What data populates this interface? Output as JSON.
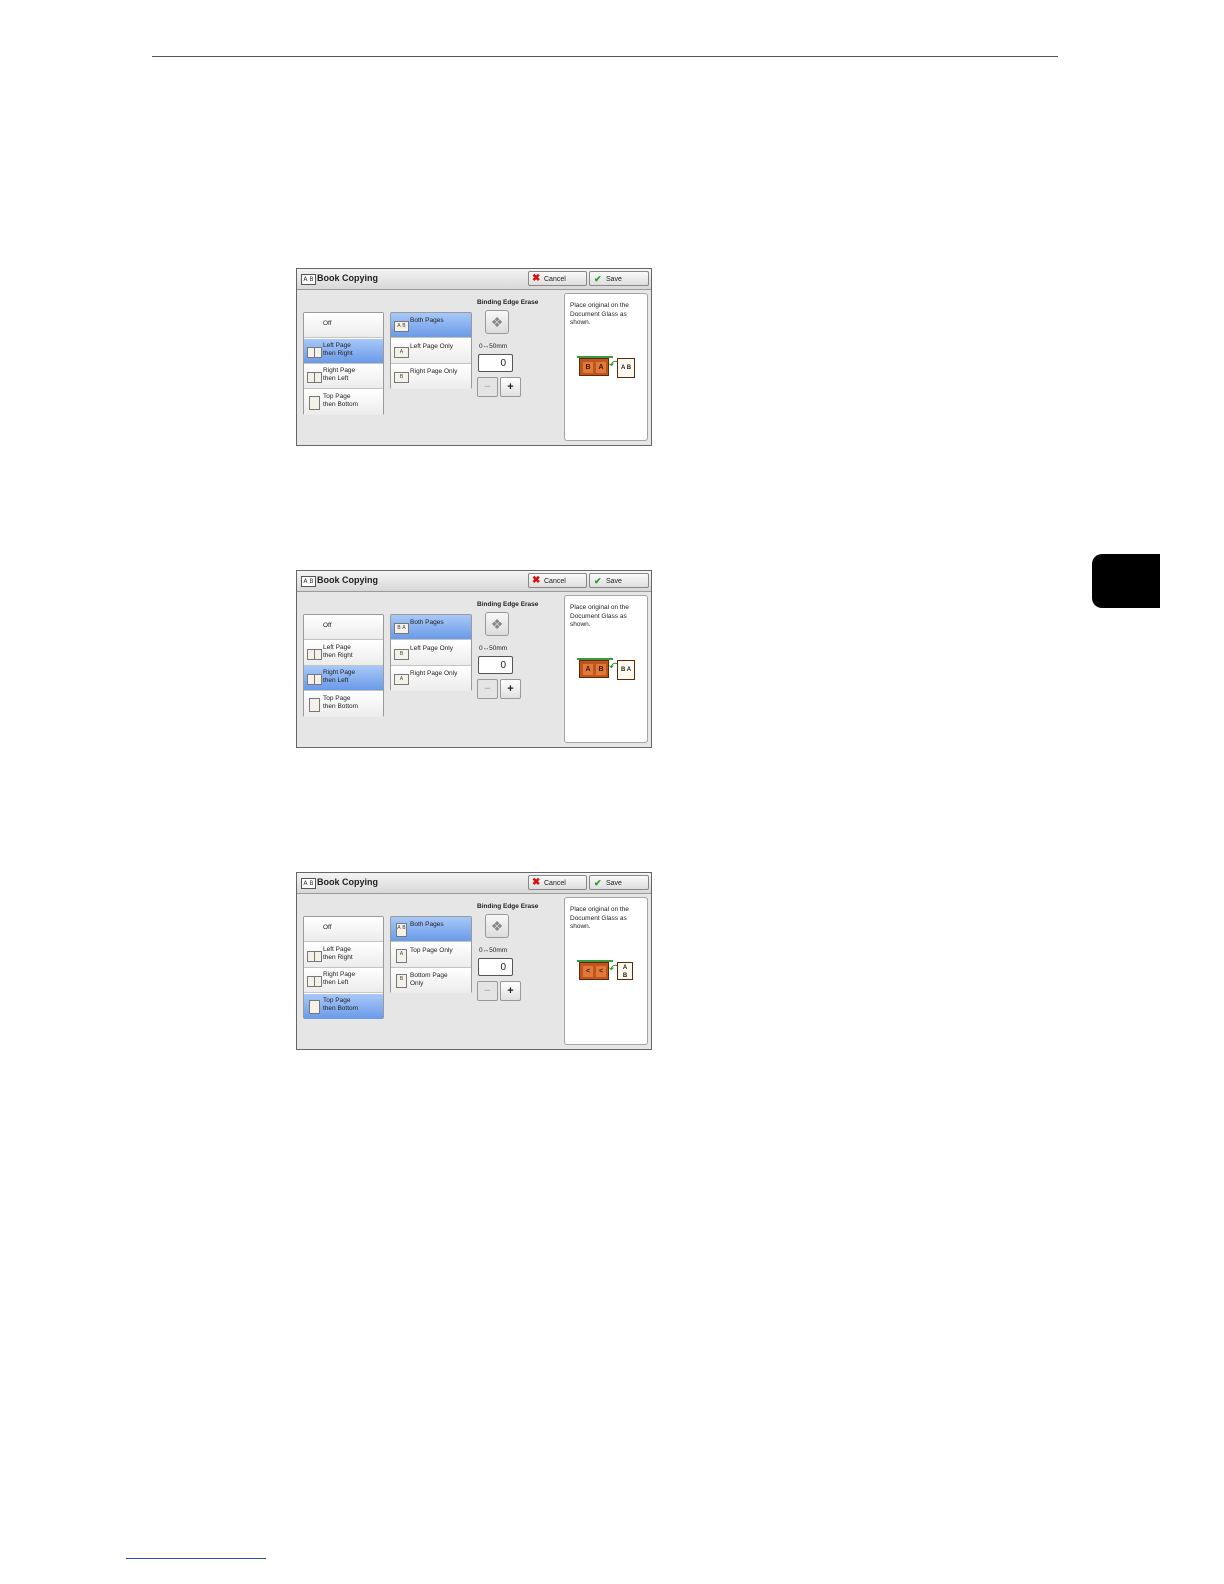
{
  "panels": [
    {
      "title": "Book Copying",
      "title_icon": "A B",
      "cancel_label": "Cancel",
      "save_label": "Save",
      "modes": [
        {
          "label": "Off",
          "icon": "",
          "selected": false
        },
        {
          "label": "Left Page\nthen Right",
          "icon": "open-book-icon",
          "selected": true
        },
        {
          "label": "Right Page\nthen Left",
          "icon": "open-book-icon",
          "selected": false
        },
        {
          "label": "Top Page\nthen Bottom",
          "icon": "vertical-book-icon",
          "selected": false
        }
      ],
      "pages": [
        {
          "label": "Both Pages",
          "icon_text": "A B",
          "selected": true
        },
        {
          "label": "Left Page Only",
          "icon_text": "A",
          "selected": false
        },
        {
          "label": "Right Page Only",
          "icon_text": "B",
          "selected": false
        }
      ],
      "edge_label": "Binding Edge Erase",
      "range_label": "0↔50mm",
      "value": "0",
      "minus": "−",
      "plus": "+",
      "info_text": "Place original on the Document Glass as shown.",
      "illustration": {
        "glass_marks": [
          "B",
          "A"
        ],
        "doc": "A B"
      }
    },
    {
      "title": "Book Copying",
      "title_icon": "A B",
      "cancel_label": "Cancel",
      "save_label": "Save",
      "modes": [
        {
          "label": "Off",
          "icon": "",
          "selected": false
        },
        {
          "label": "Left Page\nthen Right",
          "icon": "open-book-icon",
          "selected": false
        },
        {
          "label": "Right Page\nthen Left",
          "icon": "open-book-icon",
          "selected": true
        },
        {
          "label": "Top Page\nthen Bottom",
          "icon": "vertical-book-icon",
          "selected": false
        }
      ],
      "pages": [
        {
          "label": "Both Pages",
          "icon_text": "B A",
          "selected": true
        },
        {
          "label": "Left Page Only",
          "icon_text": "B",
          "selected": false
        },
        {
          "label": "Right Page Only",
          "icon_text": "A",
          "selected": false
        }
      ],
      "edge_label": "Binding Edge Erase",
      "range_label": "0↔50mm",
      "value": "0",
      "minus": "−",
      "plus": "+",
      "info_text": "Place original on the Document Glass as shown.",
      "illustration": {
        "glass_marks": [
          "A",
          "B"
        ],
        "doc": "B A"
      }
    },
    {
      "title": "Book Copying",
      "title_icon": "A B",
      "cancel_label": "Cancel",
      "save_label": "Save",
      "modes": [
        {
          "label": "Off",
          "icon": "",
          "selected": false
        },
        {
          "label": "Left Page\nthen Right",
          "icon": "open-book-icon",
          "selected": false
        },
        {
          "label": "Right Page\nthen Left",
          "icon": "open-book-icon",
          "selected": false
        },
        {
          "label": "Top Page\nthen Bottom",
          "icon": "vertical-book-icon",
          "selected": true
        }
      ],
      "pages": [
        {
          "label": "Both Pages",
          "icon_text": "A B",
          "selected": true
        },
        {
          "label": "Top Page Only",
          "icon_text": "A",
          "selected": false
        },
        {
          "label": "Bottom Page\nOnly",
          "icon_text": "B",
          "selected": false
        }
      ],
      "edge_label": "Binding Edge Erase",
      "range_label": "0↔50mm",
      "value": "0",
      "minus": "−",
      "plus": "+",
      "info_text": "Place original on the Document Glass as shown.",
      "illustration": {
        "glass_marks": [
          "<",
          "<"
        ],
        "doc": "A\nB"
      }
    }
  ]
}
